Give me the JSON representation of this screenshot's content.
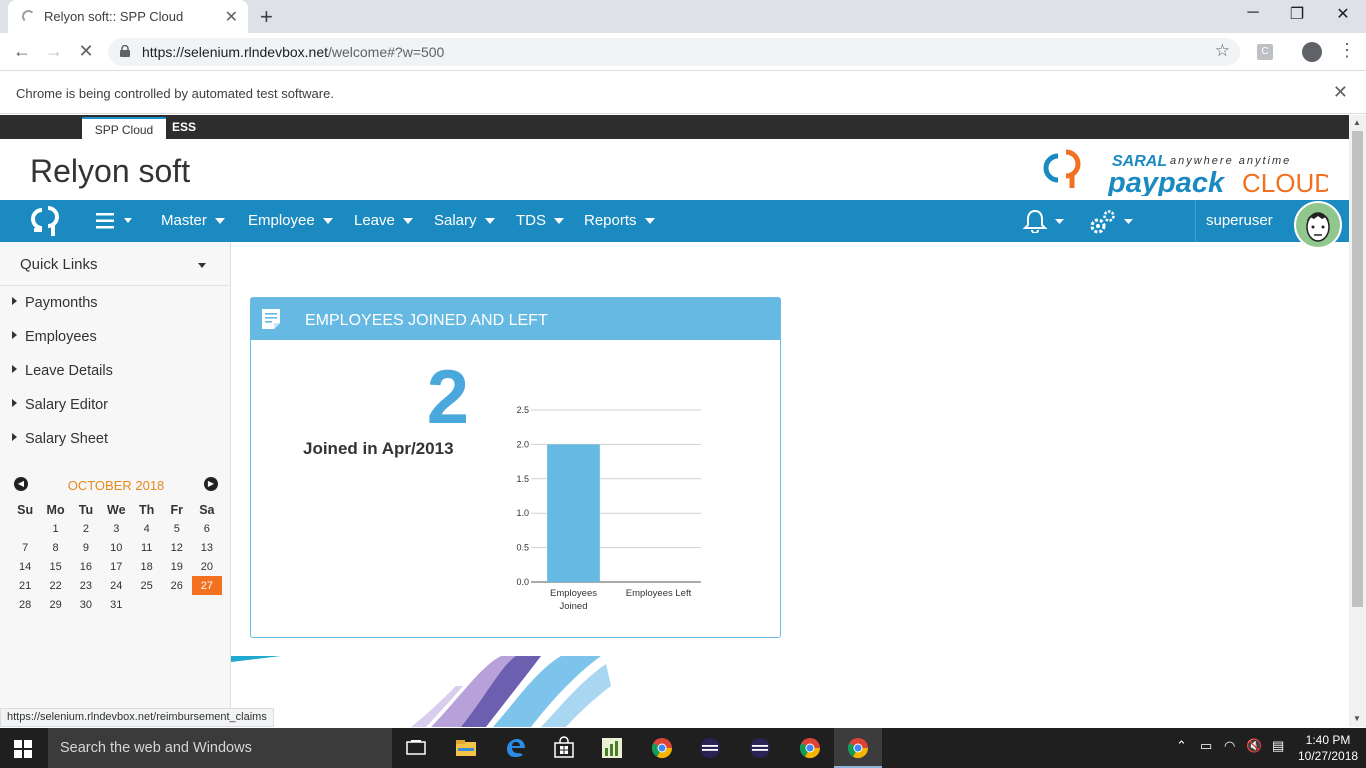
{
  "browser": {
    "tab_title": "Relyon soft:: SPP Cloud",
    "url_host": "https://selenium.rlndevbox.net",
    "url_path": "/welcome#?w=500",
    "infobar_message": "Chrome is being controlled by automated test software.",
    "status_url": "https://selenium.rlndevbox.net/reimbursement_claims",
    "extension_letter": "C"
  },
  "app": {
    "top_tabs": [
      "SPP Cloud",
      "ESS"
    ],
    "brand": "Relyon soft",
    "logo": {
      "saral": "SARAL",
      "tagline": "anywhere anytime",
      "pay": "paypack",
      "cloud": "CLOUD"
    },
    "nav_items": [
      "Master",
      "Employee",
      "Leave",
      "Salary",
      "TDS",
      "Reports"
    ],
    "username": "superuser",
    "colors": {
      "navbar": "#1b8ac1",
      "accent_orange": "#f27120",
      "widget_header": "#66b9e2",
      "big_number": "#4aa8dd"
    }
  },
  "sidebar": {
    "quick_links_label": "Quick Links",
    "links": [
      "Paymonths",
      "Employees",
      "Leave Details",
      "Salary Editor",
      "Salary Sheet"
    ],
    "calendar": {
      "month_label": "OCTOBER 2018",
      "weekdays": [
        "Su",
        "Mo",
        "Tu",
        "We",
        "Th",
        "Fr",
        "Sa"
      ],
      "weeks": [
        [
          "",
          "1",
          "2",
          "3",
          "4",
          "5",
          "6"
        ],
        [
          "7",
          "8",
          "9",
          "10",
          "11",
          "12",
          "13"
        ],
        [
          "14",
          "15",
          "16",
          "17",
          "18",
          "19",
          "20"
        ],
        [
          "21",
          "22",
          "23",
          "24",
          "25",
          "26",
          "27"
        ],
        [
          "28",
          "29",
          "30",
          "31",
          "",
          "",
          ""
        ]
      ],
      "today": "27"
    }
  },
  "widget": {
    "title": "EMPLOYEES JOINED AND LEFT",
    "big_number": "2",
    "joined_label": "Joined in Apr/2013"
  },
  "chart_data": {
    "type": "bar",
    "categories": [
      "Employees Joined",
      "Employees Left"
    ],
    "category_lines": [
      [
        "Employees",
        "Joined"
      ],
      [
        "Employees Left"
      ]
    ],
    "values": [
      2,
      0
    ],
    "ylim": [
      0,
      2.5
    ],
    "yticks": [
      "0.0",
      "0.5",
      "1.0",
      "1.5",
      "2.0",
      "2.5"
    ],
    "grid": true,
    "color": "#66b9e2"
  },
  "taskbar": {
    "search_placeholder": "Search the web and Windows",
    "time": "1:40 PM",
    "date": "10/27/2018"
  }
}
